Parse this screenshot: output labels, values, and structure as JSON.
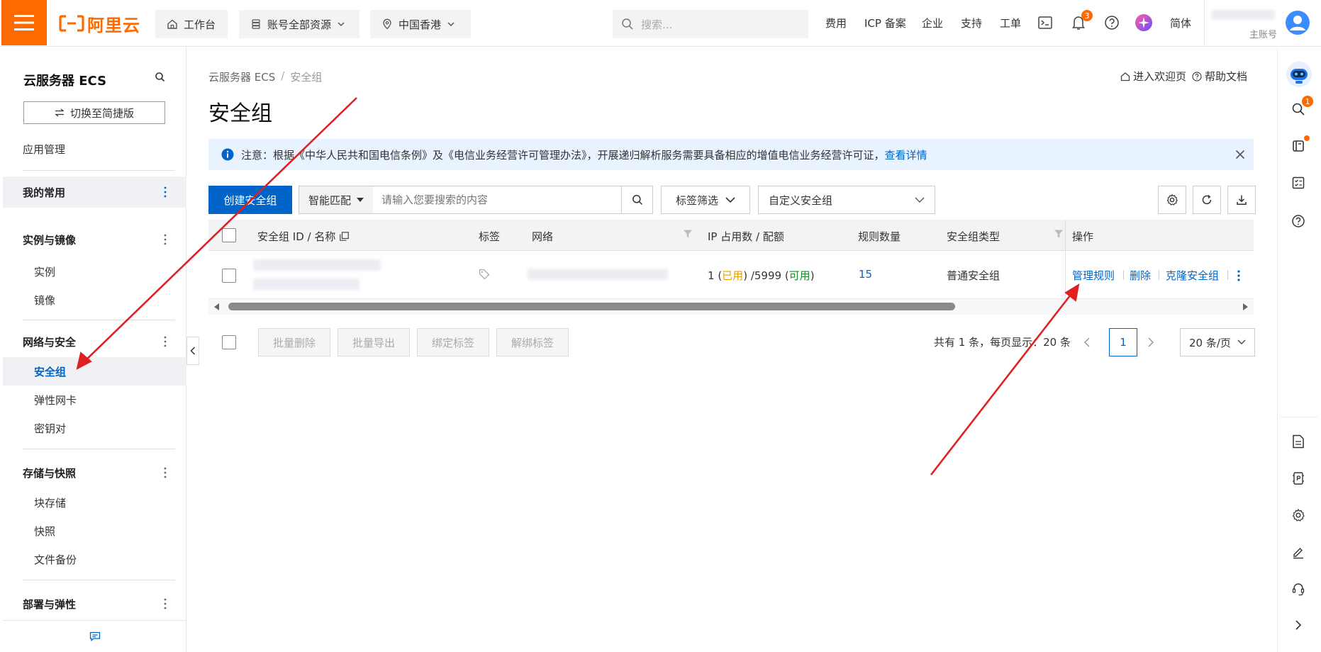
{
  "topbar": {
    "logo": "阿里云",
    "workbench": "工作台",
    "resources": "账号全部资源",
    "region": "中国香港",
    "search_placeholder": "搜索...",
    "nav": [
      "费用",
      "ICP 备案",
      "企业",
      "支持",
      "工单"
    ],
    "notification_count": "3",
    "lang": "简体",
    "account_label": "主账号"
  },
  "sidebar": {
    "title": "云服务器 ECS",
    "switch_label": "切换至简捷版",
    "app_manage": "应用管理",
    "favorites": "我的常用",
    "sections": [
      {
        "title": "实例与镜像",
        "items": [
          "实例",
          "镜像"
        ]
      },
      {
        "title": "网络与安全",
        "items": [
          "安全组",
          "弹性网卡",
          "密钥对"
        ]
      },
      {
        "title": "存储与快照",
        "items": [
          "块存储",
          "快照",
          "文件备份"
        ]
      },
      {
        "title": "部署与弹性",
        "items": []
      }
    ]
  },
  "breadcrumb": {
    "root": "云服务器 ECS",
    "sep": "/",
    "current": "安全组"
  },
  "page_title": "安全组",
  "header_links": {
    "welcome": "进入欢迎页",
    "help": "帮助文档"
  },
  "notice": {
    "text": "注意：根据《中华人民共和国电信条例》及《电信业务经营许可管理办法》，开展递归解析服务需要具备相应的增值电信业务经营许可证，",
    "link": "查看详情"
  },
  "toolbar": {
    "create": "创建安全组",
    "match": "智能匹配",
    "search_placeholder": "请输入您要搜索的内容",
    "tag_filter": "标签筛选",
    "custom_select": "自定义安全组"
  },
  "table": {
    "headers": [
      "安全组 ID / 名称",
      "标签",
      "网络",
      "IP 占用数 / 配额",
      "规则数量",
      "安全组类型",
      "操作"
    ],
    "row": {
      "ip_used_num": "1",
      "ip_used_label": "已用",
      "ip_quota": "/5999",
      "ip_avail_label": "可用",
      "rules": "15",
      "type": "普通安全组",
      "actions": [
        "管理规则",
        "删除",
        "克隆安全组"
      ]
    }
  },
  "batch": {
    "buttons": [
      "批量删除",
      "批量导出",
      "绑定标签",
      "解绑标签"
    ]
  },
  "pagination": {
    "total": "共有 1 条，每页显示：20 条",
    "current": "1",
    "page_size": "20 条/页"
  },
  "colors": {
    "brand": "#ff6a00",
    "primary": "#0064c8",
    "notice_bg": "#e8f3ff",
    "used": "#e6a100",
    "avail": "#1a8a2a",
    "arrow": "#e02020"
  }
}
